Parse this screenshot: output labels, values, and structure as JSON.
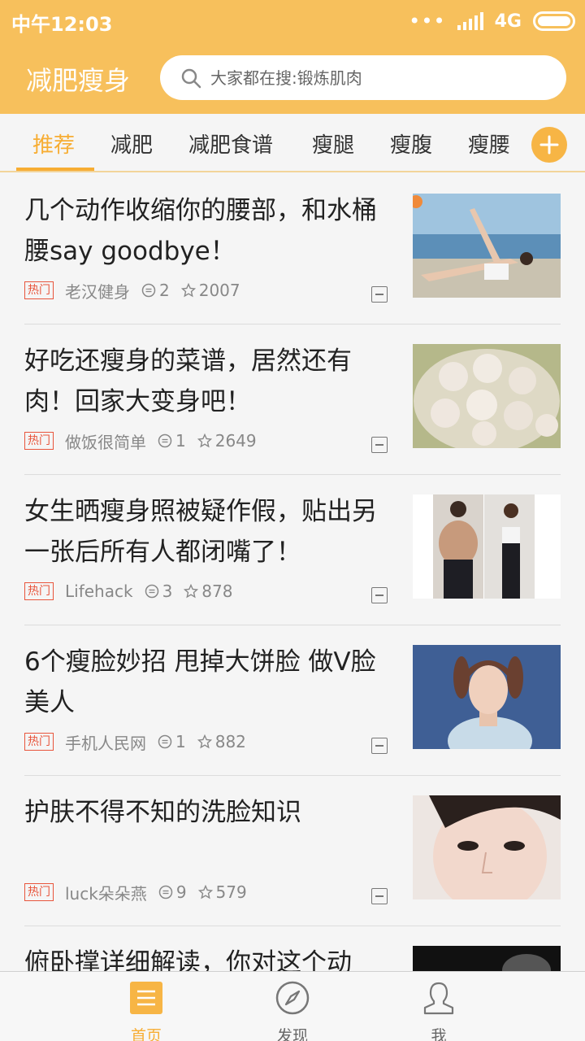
{
  "status_bar": {
    "time": "中午12:03",
    "network": "4G"
  },
  "header": {
    "title": "减肥瘦身",
    "search_placeholder": "大家都在搜:锻炼肌肉"
  },
  "tabs": [
    {
      "label": "推荐",
      "active": true
    },
    {
      "label": "减肥"
    },
    {
      "label": "减肥食谱"
    },
    {
      "label": "瘦腿"
    },
    {
      "label": "瘦腹"
    },
    {
      "label": "瘦腰"
    }
  ],
  "hot_tag": "热门",
  "feed": [
    {
      "title": "几个动作收缩你的腰部，和水桶腰say goodbye！",
      "source": "老汉健身",
      "comments": "2",
      "likes": "2007",
      "image": "woman-stretching-by-pool"
    },
    {
      "title": "好吃还瘦身的菜谱，居然还有肉！回家大变身吧！",
      "source": "做饭很简单",
      "comments": "1",
      "likes": "2649",
      "image": "meatballs-on-plate"
    },
    {
      "title": "女生晒瘦身照被疑作假，贴出另一张后所有人都闭嘴了！",
      "source": "Lifehack",
      "comments": "3",
      "likes": "878",
      "image": "before-after-photos"
    },
    {
      "title": "6个瘦脸妙招 甩掉大饼脸 做V脸美人",
      "source": "手机人民网",
      "comments": "1",
      "likes": "882",
      "image": "girl-portrait"
    },
    {
      "title": "护肤不得不知的洗脸知识",
      "source": "luck朵朵燕",
      "comments": "9",
      "likes": "579",
      "image": "woman-face-closeup"
    },
    {
      "title": "俯卧撑详细解读，你对这个动",
      "source": "",
      "comments": "",
      "likes": "",
      "image": "dark-photo"
    }
  ],
  "bottom_nav": [
    {
      "label": "首页",
      "icon": "home-list-icon",
      "active": true
    },
    {
      "label": "发现",
      "icon": "compass-icon"
    },
    {
      "label": "我",
      "icon": "user-icon"
    }
  ],
  "colors": {
    "brand": "#f7c05c",
    "accent": "#f7ad33",
    "hot": "#e8553c"
  }
}
